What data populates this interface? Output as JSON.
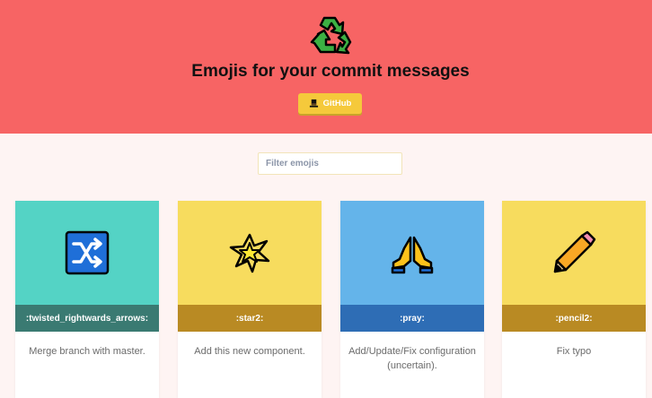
{
  "header": {
    "title": "Emojis for your commit messages",
    "github_label": "GitHub",
    "logo_icon": "recycle-icon",
    "background": "#f76464",
    "button_color": "#f5c93b"
  },
  "search": {
    "placeholder": "Filter emojis",
    "value": ""
  },
  "cards": [
    {
      "icon": "twisted-rightwards-arrows-icon",
      "code": ":twisted_rightwards_arrows:",
      "description": "Merge branch with master.",
      "top_color": "#54d3c5",
      "code_color": "#3a7a72"
    },
    {
      "icon": "star2-icon",
      "code": ":star2:",
      "description": "Add this new component.",
      "top_color": "#f7dc5e",
      "code_color": "#b98a23"
    },
    {
      "icon": "pray-icon",
      "code": ":pray:",
      "description": "Add/Update/Fix configuration (uncertain).",
      "top_color": "#64b4ea",
      "code_color": "#2e6db5"
    },
    {
      "icon": "pencil2-icon",
      "code": ":pencil2:",
      "description": "Fix typo",
      "top_color": "#f7dc5e",
      "code_color": "#b98a23"
    }
  ]
}
